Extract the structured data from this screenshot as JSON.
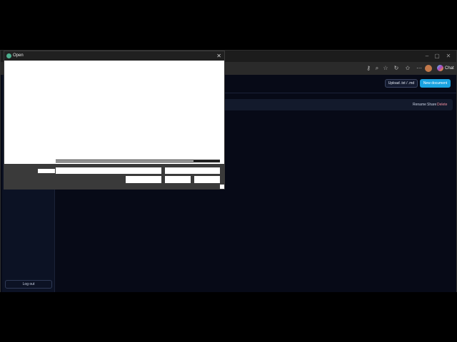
{
  "browser": {
    "copilot_label": "Chat",
    "toolbar_icons": [
      "key-icon",
      "zoom-icon",
      "star-icon",
      "refresh-icon",
      "favorites-icon",
      "more-icon",
      "profile-icon"
    ]
  },
  "app": {
    "upload_button": "Upload .txt / .md",
    "new_document_button": "New document",
    "row_actions": {
      "rename": "Rename",
      "share": "Share",
      "delete": "Delete"
    },
    "logout_button": "Log out"
  },
  "dialog": {
    "title": "Open",
    "progress": 0.84
  }
}
